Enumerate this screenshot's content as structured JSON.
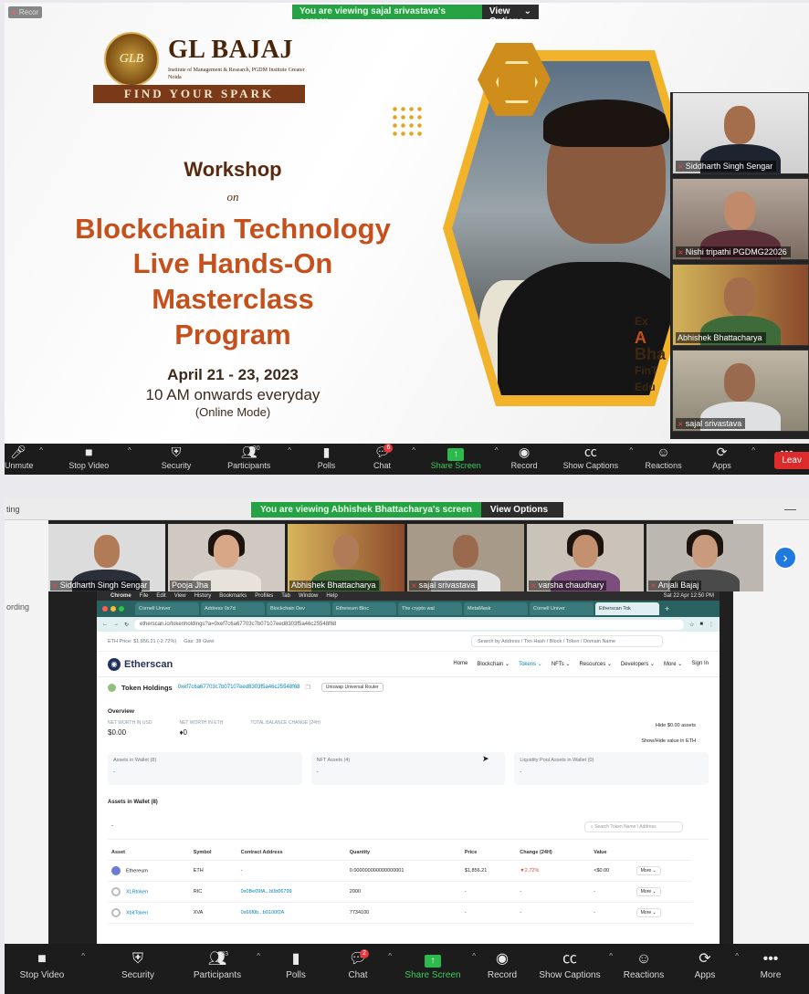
{
  "top_window": {
    "share_banner": {
      "viewing_text": "You are viewing sajal srivastava's screen",
      "view_options": "View Options",
      "chevron": "⌄"
    },
    "recording_badge": "Recor",
    "slide": {
      "logo_title": "GL BAJAJ",
      "logo_seal": "GLB",
      "logo_subtitle": "Institute of Management & Research, PGDM Institute Greater Noida",
      "logo_tagline": "FIND YOUR SPARK",
      "workshop": "Workshop",
      "on": "on",
      "line1": "Blockchain Technology",
      "line2": "Live Hands-On",
      "line3": "Masterclass",
      "line4": "Program",
      "dates": "April 21 - 23, 2023",
      "time": "10 AM onwards everyday",
      "mode": "(Online Mode)",
      "side_text": [
        "Ex",
        "A",
        "Bha",
        "FinT",
        "Edu"
      ]
    },
    "participants": [
      {
        "name": "Siddharth Singh Sengar"
      },
      {
        "name": "Nishi tripathi PGDMG22026"
      },
      {
        "name": "Abhishek Bhattacharya"
      },
      {
        "name": "sajal srivastava"
      }
    ],
    "toolbar": {
      "unmute": "Unmute",
      "stop_video": "Stop Video",
      "security": "Security",
      "participants": "Participants",
      "participants_count": "80",
      "polls": "Polls",
      "chat": "Chat",
      "chat_badge": "6",
      "share_screen": "Share Screen",
      "record": "Record",
      "show_captions": "Show Captions",
      "reactions": "Reactions",
      "apps": "Apps",
      "more": "More",
      "leave": "Leav"
    }
  },
  "bottom_window": {
    "title_fragment": "ting",
    "side_label": "ording",
    "share_banner": {
      "viewing_text": "You are viewing Abhishek Bhattacharya's screen",
      "view_options": "View Options"
    },
    "gallery": [
      {
        "name": "Siddharth Singh Sengar"
      },
      {
        "name": "Pooja Jha"
      },
      {
        "name": "Abhishek Bhattacharya"
      },
      {
        "name": "sajal srivastava"
      },
      {
        "name": "varsha chaudhary"
      },
      {
        "name": "Anjali Bajaj"
      }
    ],
    "desktop": {
      "mac_menu": [
        "Chrome",
        "File",
        "Edit",
        "View",
        "History",
        "Bookmarks",
        "Profiles",
        "Tab",
        "Window",
        "Help"
      ],
      "mac_clock": "Sat 22 Apr 12:50 PM",
      "tabs": [
        "Cornell Univer",
        "Address 0x7d",
        "Blockchain Dev",
        "Ethereum Bloc",
        "The crypto wal",
        "MetaMask",
        "Cornell Univer",
        "Etherscan Tok"
      ],
      "url": "etherscan.io/tokenholdings?a=0xef7c6a67703c7b07107eed8303f5a46c25548f68",
      "eth_price": "ETH Price: $1,856.21 (-2.72%)",
      "gas": "Gas: 38 Gwei",
      "search_placeholder": "Search by Address / Txn Hash / Block / Token / Domain Name",
      "logo": "Etherscan",
      "nav": [
        "Home",
        "Blockchain ⌄",
        "Tokens ⌄",
        "NFTs ⌄",
        "Resources ⌄",
        "Developers ⌄",
        "More ⌄",
        "Sign In"
      ],
      "token_holdings": "Token Holdings",
      "address": "0xef7c6a67703c7b07107eed8303f5a46c25548f68",
      "switch_button": "Uniswap Universal Router",
      "overview": "Overview",
      "net_worth_usd_label": "NET WORTH IN USD",
      "net_worth_usd": "$0.00",
      "net_worth_eth_label": "NET WORTH IN ETH",
      "net_worth_eth": "♦0",
      "total_balance_label": "TOTAL BALANCE CHANGE (24H)",
      "hide_assets": "Hide $0.00 assets",
      "show_hide_eth": "Show/Hide value in ETH",
      "cards": [
        {
          "title": "Assets in Wallet (8)",
          "value": "-"
        },
        {
          "title": "NFT Assets (4)",
          "value": "-"
        },
        {
          "title": "Liquidity Pool Assets in Wallet (0)",
          "value": "-"
        }
      ],
      "assets_heading": "Assets in Wallet (8)",
      "assets_dash": "-",
      "token_search_placeholder": "Search Token Name / Address",
      "table_headers": [
        "Asset",
        "Symbol",
        "Contract Address",
        "Quantity",
        "Price",
        "Change (24H)",
        "Value",
        ""
      ],
      "rows": [
        {
          "asset": "Ethereum",
          "symbol": "ETH",
          "contract": "-",
          "quantity": "0.000000000000000001",
          "price": "$1,856.21",
          "change": "▼2.72%",
          "value": "<$0.00",
          "more": "More ⌄"
        },
        {
          "asset": "XLRtoken",
          "symbol": "RIC",
          "contract": "0x0Be09fA...b0b06799",
          "quantity": "2000",
          "price": "-",
          "change": "-",
          "value": "-",
          "more": "More ⌄"
        },
        {
          "asset": "XbitToken",
          "symbol": "XVA",
          "contract": "0x66f0b...b0100f2A",
          "quantity": "7734100",
          "price": "-",
          "change": "-",
          "value": "-",
          "more": "More ⌄"
        }
      ]
    },
    "toolbar": {
      "stop_video": "Stop Video",
      "security": "Security",
      "participants": "Participants",
      "participants_count": "83",
      "polls": "Polls",
      "chat": "Chat",
      "chat_badge": "2",
      "share_screen": "Share Screen",
      "record": "Record",
      "show_captions": "Show Captions",
      "reactions": "Reactions",
      "apps": "Apps",
      "more": "More"
    }
  }
}
